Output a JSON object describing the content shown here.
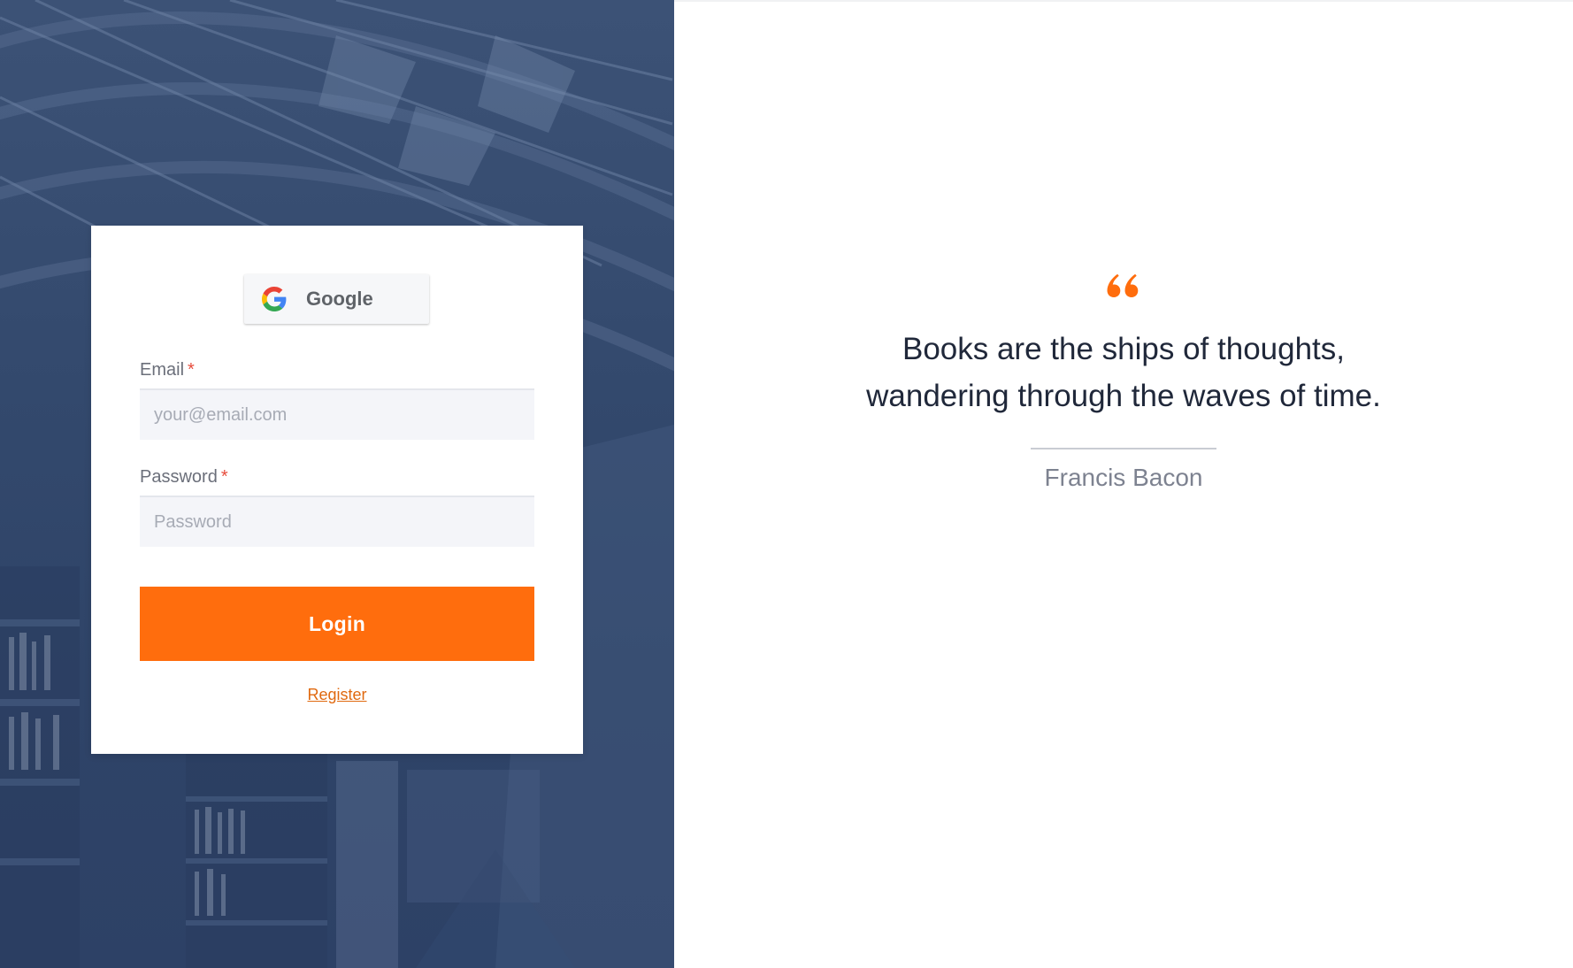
{
  "login_card": {
    "google_button_label": "Google",
    "email": {
      "label": "Email",
      "required_marker": "*",
      "placeholder": "your@email.com",
      "value": ""
    },
    "password": {
      "label": "Password",
      "required_marker": "*",
      "placeholder": "Password",
      "value": ""
    },
    "login_button_label": "Login",
    "register_link_label": "Register"
  },
  "quote": {
    "icon": "quote-icon",
    "text": "Books are the ships of thoughts, wandering through the waves of time.",
    "author": "Francis Bacon"
  },
  "colors": {
    "accent": "#ff6d0d",
    "left_panel_bg": "#33496d",
    "quote_text": "#20283a",
    "author_text": "#7d8290",
    "required_marker": "#e74c3c"
  },
  "icons": {
    "google": "google-icon",
    "quote": "quote-icon"
  }
}
